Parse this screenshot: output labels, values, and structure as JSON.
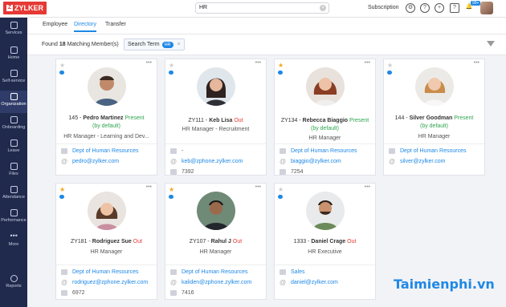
{
  "topbar": {
    "logo": "ZYLKER",
    "search_value": "HR",
    "subscription_label": "Subscription",
    "badge": "99+"
  },
  "sidebar": {
    "items": [
      {
        "label": "Services",
        "icon": "grid-icon"
      },
      {
        "label": "Home",
        "icon": "home-icon"
      },
      {
        "label": "Self-service",
        "icon": "user-icon"
      },
      {
        "label": "Organization",
        "icon": "building-icon",
        "active": true
      },
      {
        "label": "Onboarding",
        "icon": "calendar-icon"
      },
      {
        "label": "Leave",
        "icon": "calendar-icon"
      },
      {
        "label": "Files",
        "icon": "file-icon"
      },
      {
        "label": "Attendance",
        "icon": "calendar-icon"
      },
      {
        "label": "Performance",
        "icon": "trophy-icon"
      },
      {
        "label": "More",
        "icon": "more-icon"
      },
      {
        "label": "Reports",
        "icon": "reports-icon"
      }
    ]
  },
  "tabs": {
    "employee": "Employee",
    "directory": "Directory",
    "transfer": "Transfer"
  },
  "filter": {
    "found_prefix": "Found",
    "found_count": "18",
    "found_suffix": "Matching Member(s)",
    "chip_label": "Search Term",
    "chip_value": "HR",
    "chip_close": "×"
  },
  "cards": [
    {
      "starred": false,
      "id": "145",
      "name": "Pedro Martinez",
      "status": "Present",
      "status2": "(by default)",
      "role": "HR Manager - Learning and Dev...",
      "dept": "Dept of Human Resources",
      "email": "pedro@zylker.com",
      "ext": ""
    },
    {
      "starred": false,
      "id": "ZY111",
      "name": "Keb Lisa",
      "status": "Out",
      "status2": "",
      "role": "HR Manager - Recruitment",
      "dept": "-",
      "email": "keb@zphone.zylker.com",
      "ext": "7392"
    },
    {
      "starred": true,
      "id": "ZY134",
      "name": "Rebecca Biaggio",
      "status": "Present (by default)",
      "status2": "",
      "role": "HR Manager",
      "dept": "Dept of Human Resources",
      "email": "biaggio@zylker.com",
      "ext": "7254"
    },
    {
      "starred": false,
      "id": "144",
      "name": "Silver Goodman",
      "status": "Present",
      "status2": "(by default)",
      "role": "HR Manager",
      "dept": "Dept of Human Resources",
      "email": "silver@zylker.com",
      "ext": ""
    },
    {
      "starred": true,
      "id": "ZY181",
      "name": "Rodriguez Sue",
      "status": "Out",
      "status2": "",
      "role": "HR Manager",
      "dept": "Dept of Human Resources",
      "email": "rodriguez@zphone.zylker.com",
      "ext": "6972"
    },
    {
      "starred": true,
      "id": "ZY107",
      "name": "Rahul J",
      "status": "Out",
      "status2": "",
      "role": "HR Manager",
      "dept": "Dept of Human Resources",
      "email": "kaliden@zphone.zylker.com",
      "ext": "7416"
    },
    {
      "starred": false,
      "id": "1333",
      "name": "Daniel Crage",
      "status": "Out",
      "status2": "",
      "role": "HR Executive",
      "dept": "Sales",
      "email": "daniel@zylker.com",
      "ext": ""
    }
  ],
  "watermark": "Taimienphi.vn",
  "colors": {
    "accent": "#1e88e5",
    "sidebar": "#1f2a4d",
    "present": "#2ea44f",
    "out": "#e53935",
    "star": "#f4a623"
  }
}
